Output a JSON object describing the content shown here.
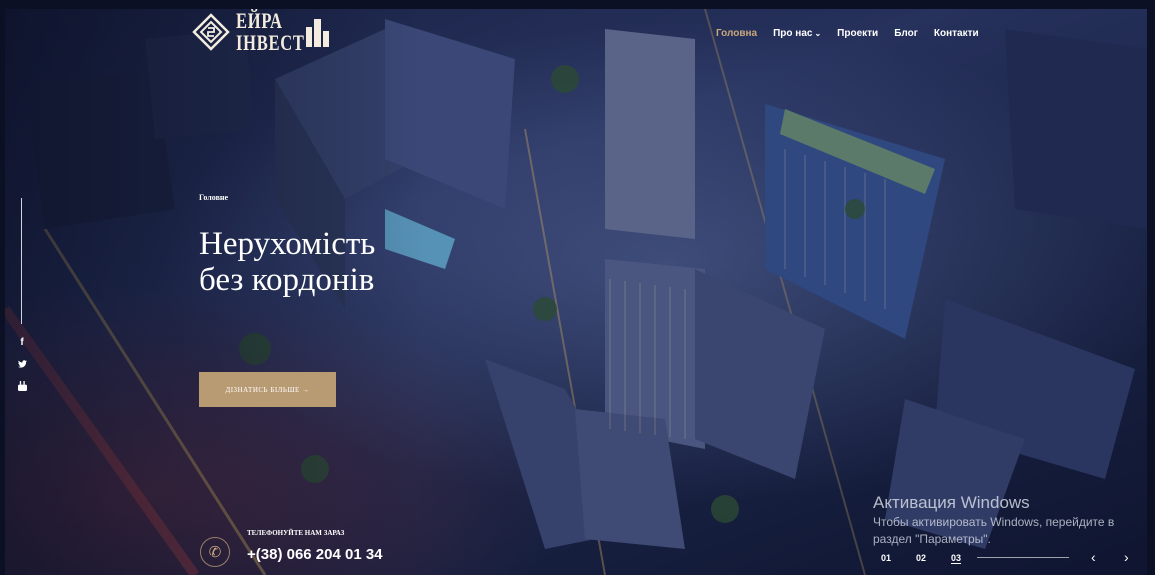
{
  "logo": {
    "line1": "ЕЙРА",
    "line2": "ІНВЕСТ"
  },
  "nav": [
    {
      "label": "Головна",
      "active": true
    },
    {
      "label": "Про нас",
      "dropdown": true
    },
    {
      "label": "Проекти"
    },
    {
      "label": "Блог"
    },
    {
      "label": "Контакти"
    }
  ],
  "breadcrumb": "Головне",
  "hero": {
    "line1": "Нерухомість",
    "line2": "без кордонів"
  },
  "cta_label": "ДІЗНАТИСЬ БІЛЬШЕ →",
  "social": [
    {
      "icon": "facebook-icon",
      "glyph": "f"
    },
    {
      "icon": "twitter-icon",
      "glyph": "🐦"
    },
    {
      "icon": "youtube-icon",
      "glyph": "▶"
    }
  ],
  "phone": {
    "label": "ТЕЛЕФОНУЙТЕ НАМ ЗАРАЗ",
    "number": "+(38) 066 204 01 34"
  },
  "windows_notice": {
    "title": "Активация Windows",
    "text": "Чтобы активировать Windows, перейдите в раздел \"Параметры\"."
  },
  "slider": {
    "pages": [
      "01",
      "02",
      "03"
    ],
    "active_index": 2,
    "prev": "‹",
    "next": "›"
  },
  "colors": {
    "accent": "#c9a77d",
    "button": "#b89a73"
  }
}
